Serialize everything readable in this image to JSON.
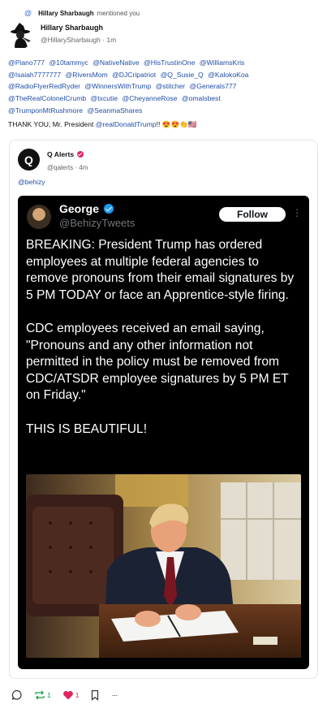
{
  "notification": {
    "name": "Hillary Sharbaugh",
    "text": "mentioned you"
  },
  "post": {
    "author_name": "Hillary Sharbaugh",
    "author_handle": "@HillarySharbaugh",
    "time": "· 1m",
    "mentions": [
      "@Piano777",
      "@10tammyc",
      "@NativeNative",
      "@HisTrustinOne",
      "@WilliamsKris",
      "@Isaiah7777777",
      "@RiversMom",
      "@DJCripatriot",
      "@Q_Susie_Q",
      "@KalokoKoa",
      "@RadioFlyerRedRyder",
      "@WinnersWithTrump",
      "@stitcher",
      "@Generals777",
      "@TheRealColonelCrumb",
      "@txcutie",
      "@CheyanneRose",
      "@omalsbest",
      "@TrumponMtRushmore",
      "@SeanmaShares"
    ],
    "thanks_prefix": "THANK YOU, Mr. President",
    "thanks_link": "@realDonaldTrump",
    "thanks_suffix": "!! 😍😍👏🇺🇸"
  },
  "quote": {
    "logo_letter": "Q",
    "author_name": "Q Alerts",
    "author_handle": "@qalerts",
    "time": "· 4m",
    "text": "@behizy",
    "embedded_tweet": {
      "name": "George",
      "handle": "@BehizyTweets",
      "follow_label": "Follow",
      "more": "⋮",
      "paragraphs": [
        "BREAKING: President Trump has ordered employees at multiple federal agencies to remove pronouns from their email signatures by 5 PM TODAY or face an Apprentice-style firing.",
        "CDC employees received an email saying, \"Pronouns and any other information not permitted in the policy must be removed from CDC/ATSDR employee signatures by 5 PM ET on Friday.\"",
        "THIS IS BEAUTIFUL!"
      ]
    }
  },
  "actions": {
    "repost_count": "1",
    "like_count": "1",
    "more": "···"
  },
  "colors": {
    "link": "#1f4ea8",
    "repost": "#17a34a",
    "like": "#e0245e",
    "verified": "#1d9bf0"
  }
}
